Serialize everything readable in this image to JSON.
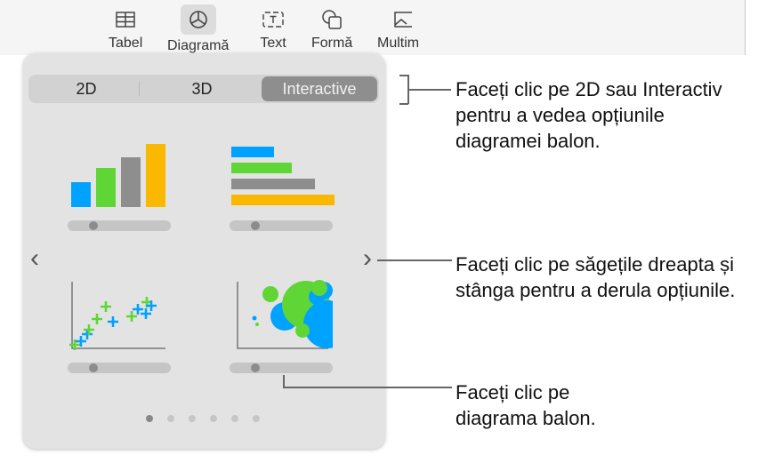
{
  "toolbar": {
    "items": [
      {
        "label": "Tabel",
        "icon": "table-icon"
      },
      {
        "label": "Diagramă",
        "icon": "chart-icon",
        "active": true
      },
      {
        "label": "Text",
        "icon": "text-box-icon"
      },
      {
        "label": "Formă",
        "icon": "shape-icon"
      },
      {
        "label": "Multim",
        "icon": "media-icon"
      }
    ]
  },
  "popover": {
    "tabs": [
      {
        "label": "2D"
      },
      {
        "label": "3D"
      },
      {
        "label": "Interactive",
        "selected": true
      }
    ],
    "page_count": 6,
    "current_page": 1
  },
  "callouts": [
    "Faceți clic pe 2D sau Interactiv pentru a vedea opțiunile diagramei balon.",
    "Faceți clic pe săgețile dreapta și stânga pentru a derula opțiunile.",
    "Faceți clic pe diagrama balon."
  ],
  "colors": {
    "blue": "#00a2ff",
    "green": "#5fd636",
    "gray": "#8e8e8e",
    "yellow": "#fbb800"
  }
}
